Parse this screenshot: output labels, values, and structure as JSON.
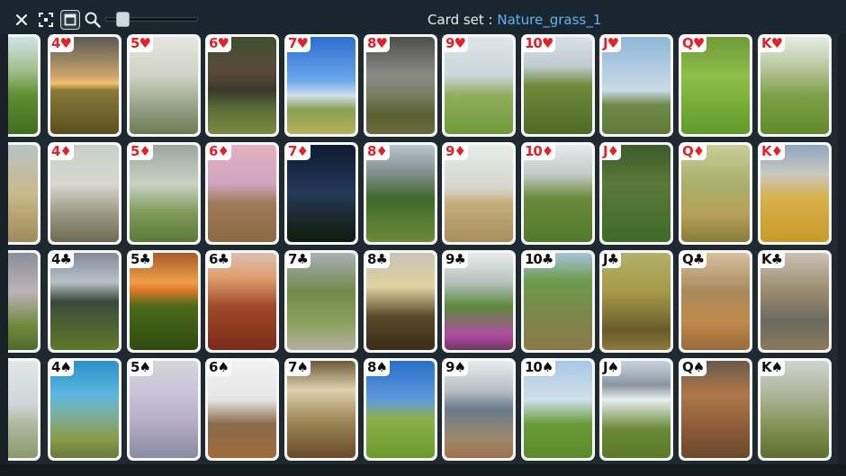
{
  "title": {
    "label": "Card set : ",
    "value": "Nature_grass_1"
  },
  "toolbar": {
    "close": "close-icon",
    "fullscreen": "fullscreen-icon",
    "window_mode": "window-mode-icon",
    "zoom": "zoom-icon",
    "zoom_level": 0.2
  },
  "rows": [
    {
      "suit": "hearts",
      "symbol": "♥",
      "color": "red",
      "cards": [
        {
          "rank": "",
          "bg": "linear-gradient(#cfe3e8 0%,#9fbf8a 35%,#5d8f2f 60%,#3f6e1f 100%)"
        },
        {
          "rank": "4",
          "bg": "linear-gradient(#5b5a55 0%,#c9a46a 40%,#f2c26b 48%,#8a7a3a 55%,#5a5020 100%)"
        },
        {
          "rank": "5",
          "bg": "linear-gradient(#e6e6e0 0%,#cfd2c4 40%,#9aa58a 70%,#6e7a55 100%)"
        },
        {
          "rank": "6",
          "bg": "linear-gradient(#405030 0%,#5a4a38 35%,#3a3a2c 55%,#5e6e3a 75%,#7a8a40 100%)"
        },
        {
          "rank": "7",
          "bg": "linear-gradient(#2d6fd0 0%,#6aa7ea 45%,#cfe0ef 60%,#8aa050 75%,#b6b060 100%)"
        },
        {
          "rank": "8",
          "bg": "linear-gradient(#4e4e4e 0%,#8a8a86 40%,#7a7e60 60%,#5a6030 80%,#6a6a3a 100%)"
        },
        {
          "rank": "9",
          "bg": "linear-gradient(#dfe6ea 0%,#c9d6da 40%,#8fae5a 60%,#6f9a3a 100%)"
        },
        {
          "rank": "10",
          "bg": "linear-gradient(#d8e0e6 0%,#c0ccd0 30%,#6f8a3a 50%,#4f6a26 100%)"
        },
        {
          "rank": "J",
          "bg": "linear-gradient(#8fb7d7 0%,#c9dbe7 55%,#6f8a4a 70%,#5f7a38 100%)"
        },
        {
          "rank": "Q",
          "bg": "linear-gradient(#6f9a3a 0%,#8fbf4a 40%,#5f9a2a 100%)"
        },
        {
          "rank": "K",
          "bg": "linear-gradient(#e8ece6 0%,#b9c9a0 30%,#7fa04a 60%,#5f8a2a 100%)"
        }
      ]
    },
    {
      "suit": "diamonds",
      "symbol": "♦",
      "color": "red",
      "cards": [
        {
          "rank": "",
          "bg": "linear-gradient(#b7c4c6 0%,#c9b98a 50%,#a08a5a 100%)"
        },
        {
          "rank": "4",
          "bg": "linear-gradient(#c8cfcc 0%,#d7d8cf 40%,#9c9a86 70%,#6e6a50 100%)"
        },
        {
          "rank": "5",
          "bg": "linear-gradient(#9aa6a0 0%,#c9d2c4 40%,#7f9a5a 70%,#5a7a3a 100%)"
        },
        {
          "rank": "6",
          "bg": "linear-gradient(#e6b0c0 0%,#cfa6c0 40%,#a07a5a 60%,#8a6a40 100%)"
        },
        {
          "rank": "7",
          "bg": "linear-gradient(#0d1a30 0%,#24395a 50%,#1a2a2a 75%,#0f1a10 100%)"
        },
        {
          "rank": "8",
          "bg": "linear-gradient(#b9c6cf 0%,#7e8e8a 30%,#3f6a2a 55%,#6a8a3a 100%)"
        },
        {
          "rank": "9",
          "bg": "linear-gradient(#e9ecea 0%,#d4d6cc 45%,#c4ae7a 60%,#a88e5a 100%)"
        },
        {
          "rank": "10",
          "bg": "linear-gradient(#e6e9ea 0%,#c4cbc8 30%,#6a8a3a 55%,#4f7a2a 100%)"
        },
        {
          "rank": "J",
          "bg": "linear-gradient(#3a5a2a 0%,#5a7a3a 40%,#3f6a28 100%)"
        },
        {
          "rank": "Q",
          "bg": "linear-gradient(#c8cf9a 0%,#a8b06a 40%,#b6a25a 70%,#8a7a3a 100%)"
        },
        {
          "rank": "K",
          "bg": "linear-gradient(#8fa6c0 0%,#c9c9c0 30%,#d8b04a 55%,#c89a2a 100%)"
        }
      ]
    },
    {
      "suit": "clubs",
      "symbol": "♣",
      "color": "black",
      "cards": [
        {
          "rank": "",
          "bg": "linear-gradient(#8a8f9a 0%,#bcb2b6 40%,#6f8a3a 75%,#4f6a2a 100%)"
        },
        {
          "rank": "4",
          "bg": "linear-gradient(#808c96 0%,#b9c0c8 30%,#3a4a3a 50%,#5f7a2a 100%)"
        },
        {
          "rank": "5",
          "bg": "linear-gradient(#a65a2a 0%,#f0a04a 30%,#e07a2a 38%,#4a6a1a 55%,#2f4a10 100%)"
        },
        {
          "rank": "6",
          "bg": "linear-gradient(#d8c0b0 0%,#e0a070 25%,#a04a2a 55%,#7a2a1a 100%)"
        },
        {
          "rank": "7",
          "bg": "linear-gradient(#a8b0b4 0%,#6f8a4a 40%,#8aa05a 70%,#b2b0a0 100%)"
        },
        {
          "rank": "8",
          "bg": "linear-gradient(#c7c4b6 0%,#e0d2a0 35%,#5a4a2a 65%,#3a2e1a 100%)"
        },
        {
          "rank": "9",
          "bg": "linear-gradient(#e9eaea 0%,#b8c2c0 30%,#5a8a3a 55%,#b04aa0 85%,#6a3a5a 100%)"
        },
        {
          "rank": "10",
          "bg": "linear-gradient(#a8c4d8 0%,#6a9a4a 30%,#7a8a4a 60%,#8a7a4a 100%)"
        },
        {
          "rank": "J",
          "bg": "linear-gradient(#b2b06a 0%,#a69a4a 40%,#6a5a2a 80%,#8a7a3a 100%)"
        },
        {
          "rank": "Q",
          "bg": "linear-gradient(#d8c0a0 0%,#a88a5a 40%,#c08a4a 70%,#9a6a3a 100%)"
        },
        {
          "rank": "K",
          "bg": "linear-gradient(#c9c2b6 0%,#9a8a6a 40%,#6a6a60 70%,#8a7a5a 100%)"
        }
      ]
    },
    {
      "suit": "spades",
      "symbol": "♠",
      "color": "black",
      "cards": [
        {
          "rank": "",
          "bg": "linear-gradient(#e3e6e6 0%,#cfd6d6 45%,#b0b8a0 65%,#8a9a6a 100%)"
        },
        {
          "rank": "4",
          "bg": "linear-gradient(#2a90c8 0%,#5cb7e0 35%,#7ab0a0 55%,#8a9a4a 80%,#6a7a3a 100%)"
        },
        {
          "rank": "5",
          "bg": "linear-gradient(#d6d6dc 0%,#c8c2d8 35%,#b8b0c8 60%,#8a8aa0 100%)"
        },
        {
          "rank": "6",
          "bg": "linear-gradient(#f2f2f2 0%,#e6e6e6 40%,#8a6a4a 65%,#a06a3a 100%)"
        },
        {
          "rank": "7",
          "bg": "linear-gradient(#6a5a3a 0%,#e0d2b0 30%,#a08a5a 60%,#6a4a2a 100%)"
        },
        {
          "rank": "8",
          "bg": "linear-gradient(#2a6ec8 0%,#5f9ae0 40%,#8ab04a 60%,#6a9a2a 100%)"
        },
        {
          "rank": "9",
          "bg": "linear-gradient(#e8ecec 0%,#b8c0c4 30%,#6a7a8a 50%,#9a8a6a 80%,#a0704a 100%)"
        },
        {
          "rank": "10",
          "bg": "linear-gradient(#a6c8e6 0%,#d0e0ea 40%,#6a9a3a 65%,#5a8a2a 100%)"
        },
        {
          "rank": "J",
          "bg": "linear-gradient(#c8d4de 0%,#8a96a0 25%,#e8eef0 40%,#6a8a3a 70%,#5a7a2a 100%)"
        },
        {
          "rank": "Q",
          "bg": "linear-gradient(#6a5a4a 0%,#b0784a 35%,#8a5a3a 70%,#6a4a2a 100%)"
        },
        {
          "rank": "K",
          "bg": "linear-gradient(#d0d4d2 0%,#a8b090 40%,#7a8a4a 75%,#5f6e30 100%)"
        }
      ]
    }
  ]
}
